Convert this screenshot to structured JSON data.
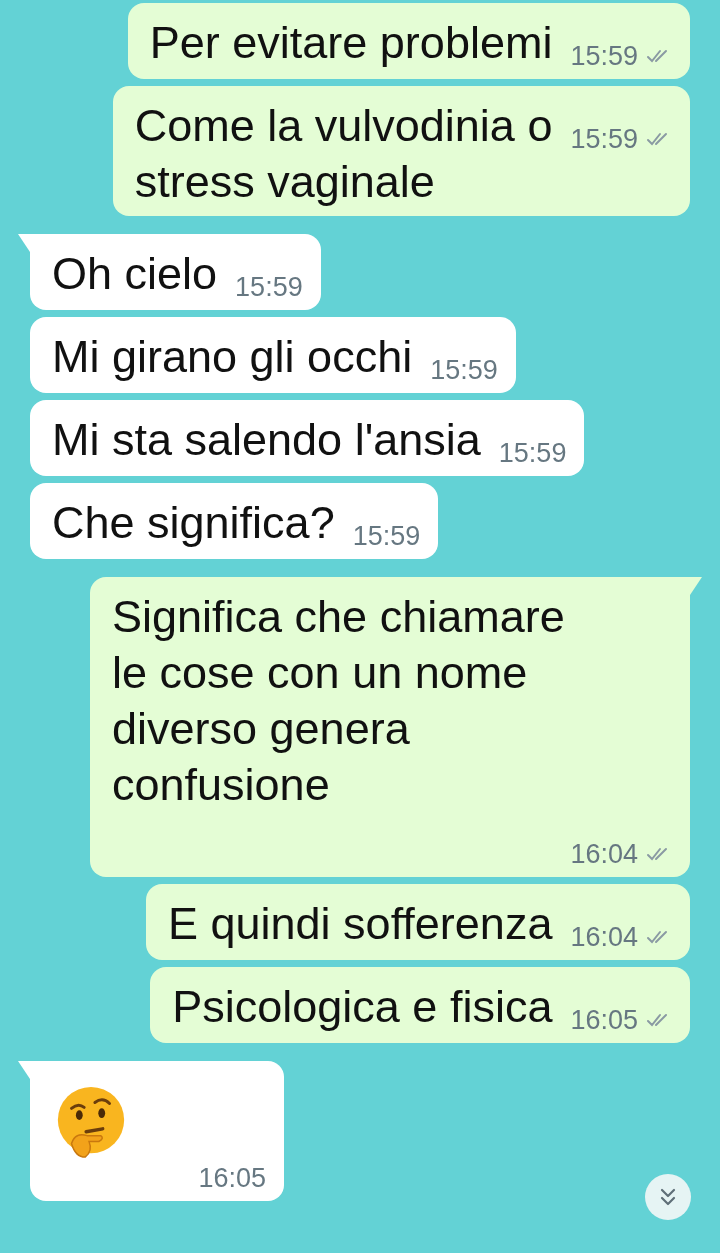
{
  "messages": [
    {
      "outgoing": true,
      "kind": "text",
      "tail": false,
      "text": "Per evitare problemi",
      "time": "15:59",
      "read": false
    },
    {
      "outgoing": true,
      "kind": "text",
      "tail": false,
      "text": "Come la vulvodinia o\nstress vaginale",
      "time": "15:59",
      "read": false
    },
    {
      "outgoing": false,
      "kind": "text",
      "tail": true,
      "text": "Oh cielo",
      "time": "15:59"
    },
    {
      "outgoing": false,
      "kind": "text",
      "tail": false,
      "text": "Mi girano gli occhi",
      "time": "15:59"
    },
    {
      "outgoing": false,
      "kind": "text",
      "tail": false,
      "text": "Mi sta salendo l'ansia",
      "time": "15:59"
    },
    {
      "outgoing": false,
      "kind": "text",
      "tail": false,
      "text": "Che significa?",
      "time": "15:59"
    },
    {
      "outgoing": true,
      "kind": "text",
      "tail": true,
      "text": "Significa che chiamare\nle cose con un nome\ndiverso genera\nconfusione",
      "time": "16:04",
      "read": false
    },
    {
      "outgoing": true,
      "kind": "text",
      "tail": false,
      "text": "E quindi sofferenza",
      "time": "16:04",
      "read": false
    },
    {
      "outgoing": true,
      "kind": "text",
      "tail": false,
      "text": "Psicologica e fisica",
      "time": "16:05",
      "read": false
    },
    {
      "outgoing": false,
      "kind": "emoji",
      "tail": true,
      "time": "16:05"
    }
  ]
}
